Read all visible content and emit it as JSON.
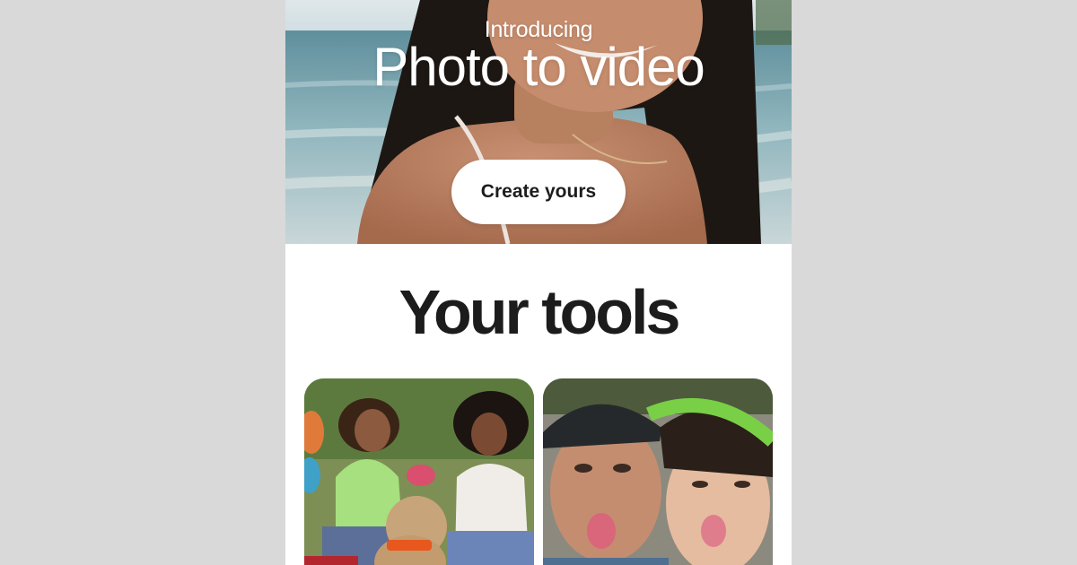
{
  "hero": {
    "intro": "Introducing",
    "title": "Photo to video",
    "cta_label": "Create yours",
    "image": "woman-smiling-at-beach"
  },
  "tools": {
    "heading": "Your tools",
    "cards": [
      {
        "image": "friends-with-dog-on-grass"
      },
      {
        "image": "couple-selfie-tongues-out"
      }
    ]
  },
  "colors": {
    "page_bg": "#d9d9d9",
    "panel_bg": "#ffffff",
    "heading_text": "#1c1c1c",
    "button_bg": "#ffffff"
  }
}
